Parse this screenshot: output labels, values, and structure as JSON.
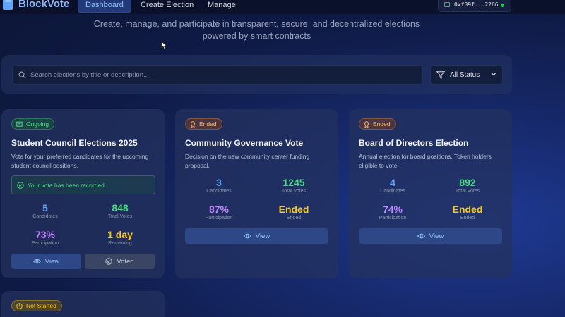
{
  "app": {
    "name": "BlockVote"
  },
  "nav": {
    "items": [
      {
        "label": "Dashboard",
        "active": true
      },
      {
        "label": "Create Election",
        "active": false
      },
      {
        "label": "Manage",
        "active": false
      }
    ]
  },
  "wallet": {
    "address": "0xf39f...2266",
    "status_color": "#22c55e"
  },
  "hero": {
    "subtitle_line1": "Create, manage, and participate in transparent, secure, and decentralized elections",
    "subtitle_line2": "powered by smart contracts"
  },
  "filters": {
    "search_placeholder": "Search elections by title or description...",
    "search_value": "",
    "status_selected": "All Status"
  },
  "elections": [
    {
      "status": "Ongoing",
      "title": "Student Council Elections 2025",
      "description": "Vote for your preferred candidates for the upcoming student council positions.",
      "notice": "Your vote has been recorded.",
      "stats": [
        {
          "value": "5",
          "label": "Candidates"
        },
        {
          "value": "848",
          "label": "Total Votes"
        },
        {
          "value": "73%",
          "label": "Participation"
        },
        {
          "value": "1 day",
          "label": "Remaining"
        }
      ],
      "view_label": "View",
      "voted_label": "Voted"
    },
    {
      "status": "Ended",
      "title": "Community Governance Vote",
      "description": "Decision on the new community center funding proposal.",
      "stats": [
        {
          "value": "3",
          "label": "Candidates"
        },
        {
          "value": "1245",
          "label": "Total Votes"
        },
        {
          "value": "87%",
          "label": "Participation"
        },
        {
          "value": "Ended",
          "label": "Ended"
        }
      ],
      "view_label": "View"
    },
    {
      "status": "Ended",
      "title": "Board of Directors Election",
      "description": "Annual election for board positions. Token holders eligible to vote.",
      "stats": [
        {
          "value": "4",
          "label": "Candidates"
        },
        {
          "value": "892",
          "label": "Total Votes"
        },
        {
          "value": "74%",
          "label": "Participation"
        },
        {
          "value": "Ended",
          "label": "Ended"
        }
      ],
      "view_label": "View"
    },
    {
      "status": "Not Started"
    }
  ],
  "colors": {
    "candidates": "#60a5fa",
    "votes": "#4ade80",
    "participation": "#c084fc",
    "time": "#facc15"
  }
}
